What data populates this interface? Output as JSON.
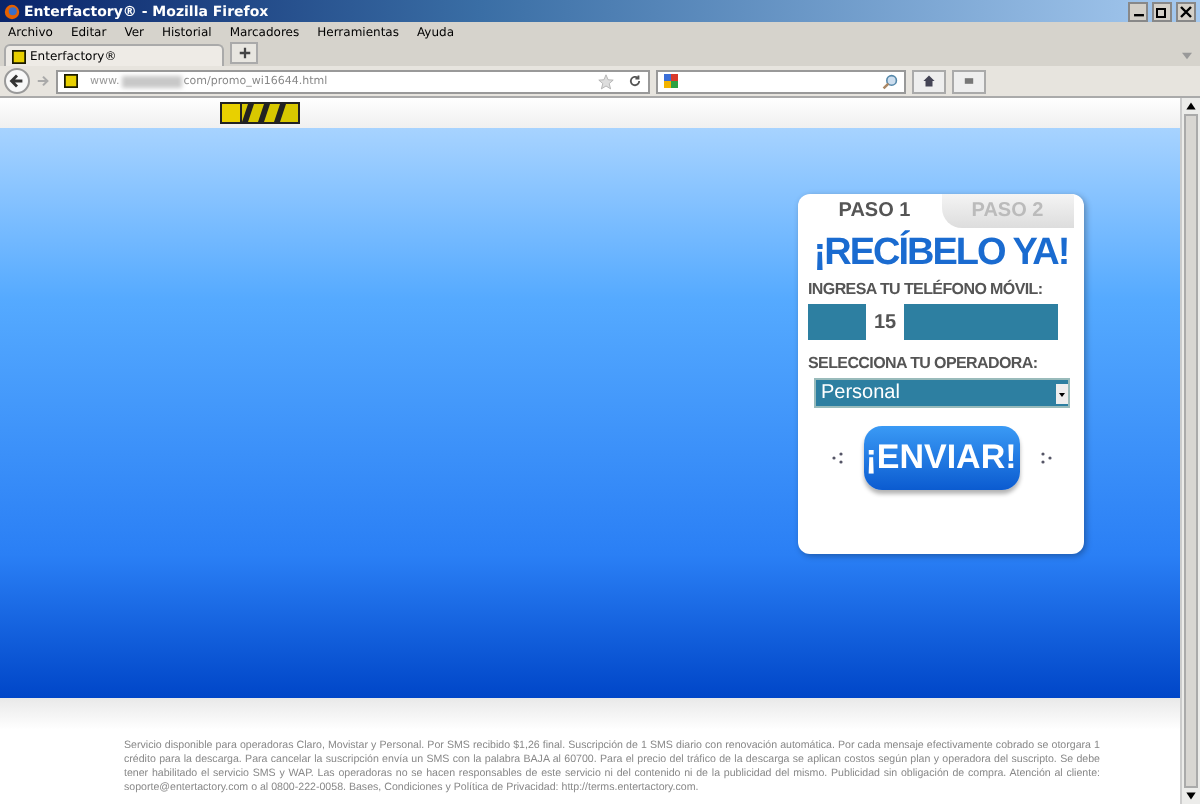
{
  "window": {
    "title": "Enterfactory® - Mozilla Firefox"
  },
  "menu": [
    "Archivo",
    "Editar",
    "Ver",
    "Historial",
    "Marcadores",
    "Herramientas",
    "Ayuda"
  ],
  "tabs": [
    {
      "label": "Enterfactory®"
    }
  ],
  "address_bar": {
    "prefix": "www.",
    "value": "com/promo_wi16644.html"
  },
  "form": {
    "steps": [
      {
        "label": "PASO 1",
        "selected": true
      },
      {
        "label": "PASO 2",
        "selected": false
      }
    ],
    "headline": "¡RECÍBELO YA!",
    "phone_label": "INGRESA TU TELÉFONO MÓVIL:",
    "phone_prefix": "15",
    "operator_label": "SELECCIONA TU OPERADORA:",
    "operator": "Personal",
    "submit": "¡ENVIAR!"
  },
  "footer": "Servicio disponible para operadoras Claro, Movistar y Personal. Por SMS recibido $1,26 final. Suscripción de 1 SMS diario con renovación automática. Por cada mensaje efectivamente cobrado se otorgara 1 crédito para la descarga. Para cancelar la suscripción envía un SMS con la palabra BAJA al 60700. Para el precio del tráfico de la descarga se aplican costos según plan y operadora del suscripto. Se debe tener habilitado el servicio SMS y WAP. Las operadoras no se hacen responsables de este servicio ni del contenido ni de la publicidad del mismo. Publicidad sin obligación de compra. Atención al cliente: soporte@entertactory.com o al 0800-222-0058. Bases, Condiciones y Política de Privacidad: http://terms.entertactory.com."
}
